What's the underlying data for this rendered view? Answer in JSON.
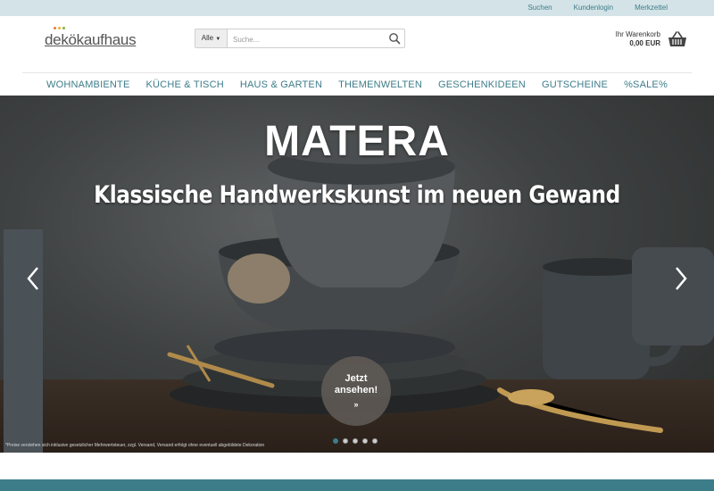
{
  "topbar": {
    "links": [
      "Suchen",
      "Kundenlogin",
      "Merkzettel"
    ]
  },
  "logo": {
    "text_prefix": "d",
    "text_o": "e",
    "text_rest": "kökaufhaus",
    "full": "dekokaufhaus"
  },
  "search": {
    "category": "Alle",
    "placeholder": "Suche...",
    "value": ""
  },
  "cart": {
    "label": "Ihr Warenkorb",
    "amount": "0,00 EUR"
  },
  "nav": {
    "items": [
      "WOHNAMBIENTE",
      "KÜCHE & TISCH",
      "HAUS & GARTEN",
      "THEMENWELTEN",
      "GESCHENKIDEEN",
      "GUTSCHEINE",
      "%SALE%"
    ]
  },
  "hero": {
    "title": "MATERA",
    "subtitle": "Klassische Handwerkskunst im neuen Gewand",
    "cta_line1": "Jetzt",
    "cta_line2": "ansehen!",
    "cta_chevron": "»",
    "disclaimer": "*Preise verstehen sich inklusive gesetzlicher Mehrwertsteuer, zzgl. Versand, Versand erfolgt ohne eventuell abgebildete Dekoration",
    "slide_count": 5,
    "active_slide": 1
  },
  "colors": {
    "accent": "#3d7d8a",
    "topbar_bg": "#d4e3e7",
    "logo_dot_1": "#e07b39",
    "logo_dot_2": "#f0b429",
    "logo_dot_3": "#7ab648"
  },
  "icons": {
    "search": "search-icon",
    "cart": "basket-icon",
    "prev": "chevron-left-icon",
    "next": "chevron-right-icon"
  }
}
